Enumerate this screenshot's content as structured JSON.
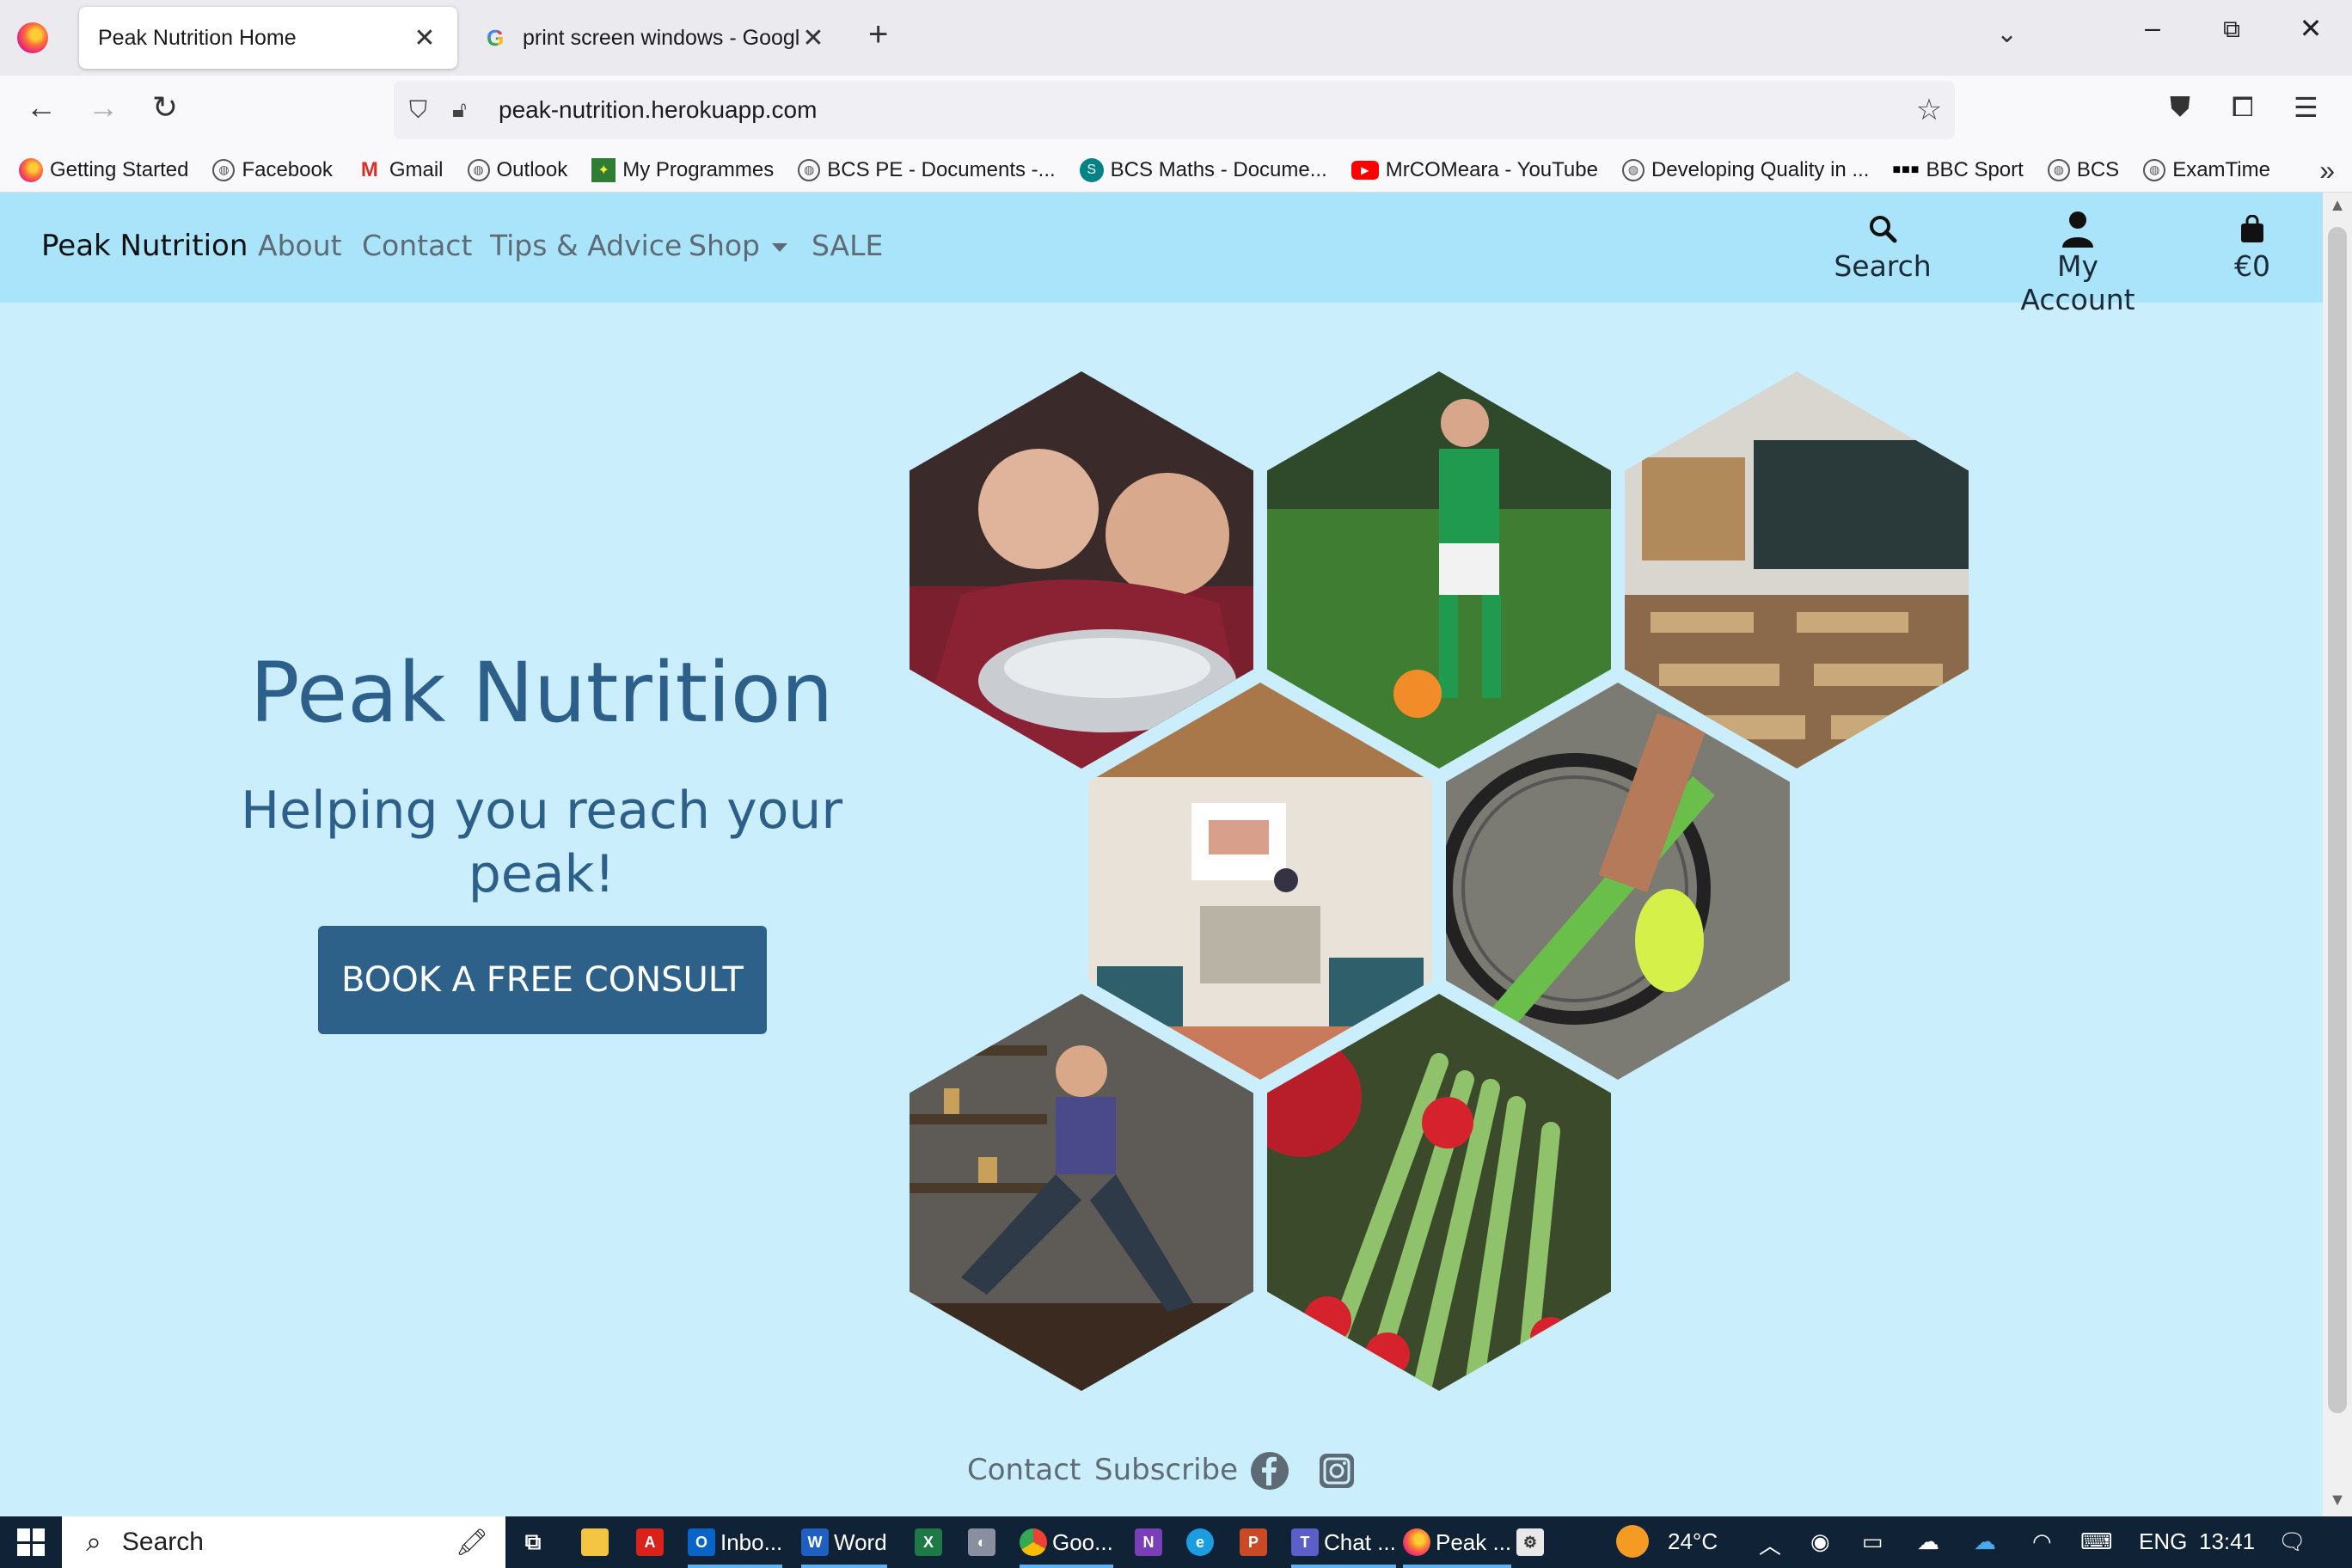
{
  "browser": {
    "tabs": [
      {
        "title": "Peak Nutrition Home",
        "active": true
      },
      {
        "title": "print screen windows - Google S",
        "active": false
      }
    ],
    "url": "peak-nutrition.herokuapp.com",
    "bookmarks": [
      {
        "label": "Getting Started",
        "icon": "firefox-icon"
      },
      {
        "label": "Facebook",
        "icon": "globe-icon"
      },
      {
        "label": "Gmail",
        "icon": "gmail-icon"
      },
      {
        "label": "Outlook",
        "icon": "globe-icon"
      },
      {
        "label": "My Programmes",
        "icon": "programmes-icon"
      },
      {
        "label": "BCS PE - Documents -...",
        "icon": "globe-icon"
      },
      {
        "label": "BCS Maths - Docume...",
        "icon": "sharepoint-icon"
      },
      {
        "label": "MrCOMeara - YouTube",
        "icon": "youtube-icon"
      },
      {
        "label": "Developing Quality in ...",
        "icon": "globe-icon"
      },
      {
        "label": "BBC Sport",
        "icon": "bbc-icon"
      },
      {
        "label": "BCS",
        "icon": "globe-icon"
      },
      {
        "label": "ExamTime",
        "icon": "globe-icon"
      }
    ]
  },
  "site": {
    "brand": "Peak Nutrition",
    "nav": {
      "about": "About",
      "contact": "Contact",
      "tips": "Tips & Advice",
      "shop": "Shop",
      "sale": "SALE"
    },
    "tools": {
      "search": "Search",
      "account": "My Account",
      "bag": "€0"
    },
    "hero": {
      "title": "Peak Nutrition",
      "subtitle": "Helping you reach your peak!",
      "cta": "BOOK A FREE CONSULT"
    },
    "footer": {
      "contact": "Contact",
      "subscribe": "Subscribe"
    },
    "colors": {
      "page_bg": "#cbeefc",
      "navbar_bg": "#a9e4fa",
      "heading": "#2c5f89",
      "button": "#2d6189"
    }
  },
  "taskbar": {
    "search": "Search",
    "apps": {
      "outlook": "Inbo...",
      "word": "Word",
      "chrome": "Goo...",
      "teams": "Chat ...",
      "firefox": "Peak ..."
    },
    "weather": "24°C",
    "language": "ENG",
    "time": "13:41"
  }
}
